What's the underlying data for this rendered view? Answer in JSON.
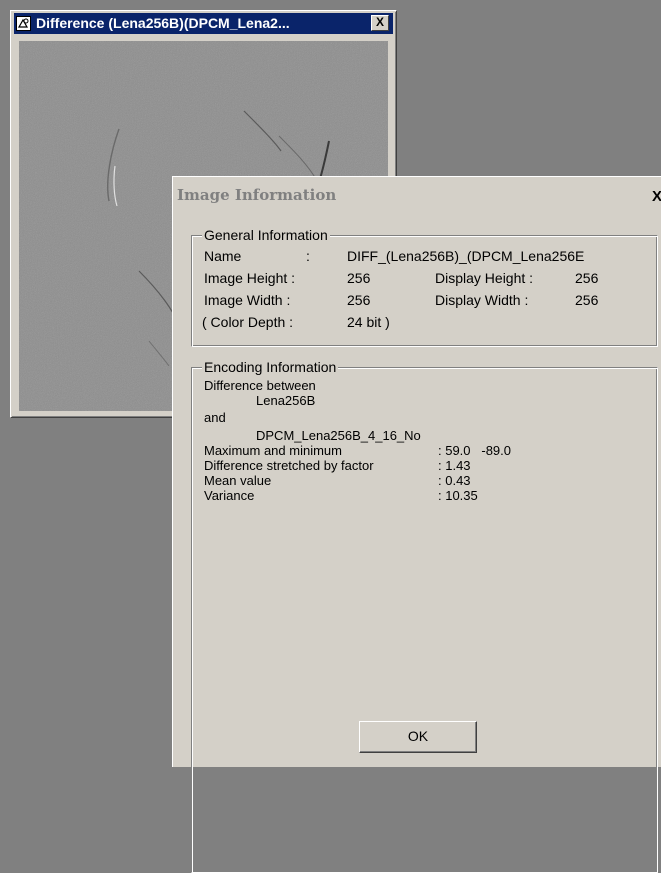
{
  "window_difference": {
    "title": "Difference (Lena256B)(DPCM_Lena2...",
    "close_label": "X"
  },
  "dialog": {
    "title": "Image Information",
    "close_label": "X",
    "general": {
      "legend": "General Information",
      "name_label": "Name",
      "name_sep": ":",
      "name_value": "DIFF_(Lena256B)_(DPCM_Lena256E",
      "image_height_label": "Image Height :",
      "image_height_value": "256",
      "display_height_label": "Display Height :",
      "display_height_value": "256",
      "image_width_label": "Image Width :",
      "image_width_value": "256",
      "display_width_label": "Display Width :",
      "display_width_value": "256",
      "color_depth_label": "( Color Depth :",
      "color_depth_value": "24 bit )"
    },
    "encoding": {
      "legend": "Encoding Information",
      "line1": "Difference between",
      "line2": "Lena256B",
      "line3": "and",
      "line4": "DPCM_Lena256B_4_16_No",
      "maxmin_label": "Maximum and minimum",
      "maxmin_value": ": 59.0   -89.0",
      "stretch_label": "Difference stretched by factor",
      "stretch_value": ": 1.43",
      "mean_label": "Mean value",
      "mean_value": ": 0.43",
      "variance_label": "Variance",
      "variance_value": ": 10.35"
    },
    "ok_label": "OK"
  },
  "colors": {
    "titlebar_active": "#0a246a",
    "face": "#d4d0c8",
    "desktop": "#808080"
  }
}
